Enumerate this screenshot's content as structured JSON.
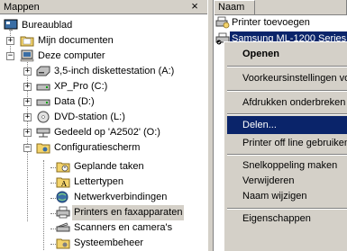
{
  "folders_pane": {
    "title": "Mappen",
    "close_glyph": "×",
    "tree": [
      {
        "label": "Bureaublad",
        "icon": "desktop-icon"
      },
      {
        "label": "Mijn documenten",
        "icon": "folder-icon",
        "expander": "+"
      },
      {
        "label": "Deze computer",
        "icon": "computer-icon",
        "expander": "−"
      },
      {
        "label": "3,5-inch diskettestation (A:)",
        "icon": "floppy-drive-icon",
        "expander": "+"
      },
      {
        "label": "XP_Pro (C:)",
        "icon": "hard-drive-icon",
        "expander": "+"
      },
      {
        "label": "Data (D:)",
        "icon": "hard-drive-icon",
        "expander": "+"
      },
      {
        "label": "DVD-station (L:)",
        "icon": "dvd-drive-icon",
        "expander": "+"
      },
      {
        "label": "Gedeeld op 'A2502' (O:)",
        "icon": "network-drive-icon",
        "expander": "+"
      },
      {
        "label": "Configuratiescherm",
        "icon": "control-panel-icon",
        "expander": "−"
      },
      {
        "label": "Geplande taken",
        "icon": "scheduled-tasks-icon"
      },
      {
        "label": "Lettertypen",
        "icon": "fonts-folder-icon"
      },
      {
        "label": "Netwerkverbindingen",
        "icon": "network-connections-icon"
      },
      {
        "label": "Printers en faxapparaten",
        "icon": "printers-icon",
        "selected": true
      },
      {
        "label": "Scanners en camera's",
        "icon": "scanner-camera-icon"
      },
      {
        "label": "Systeembeheer",
        "icon": "admin-tools-icon"
      }
    ]
  },
  "list_pane": {
    "column_name": "Naam",
    "items": [
      {
        "label": "Printer toevoegen",
        "icon": "add-printer-icon"
      },
      {
        "label": "Samsung ML-1200 Series",
        "icon": "printer-icon",
        "selected": true
      }
    ]
  },
  "context_menu": {
    "items": [
      {
        "label": "Openen",
        "bold": true
      },
      {
        "separator": true
      },
      {
        "label": "Voorkeursinstellingen voor afdrukken..."
      },
      {
        "separator": true
      },
      {
        "label": "Afdrukken onderbreken"
      },
      {
        "separator": true
      },
      {
        "label": "Delen...",
        "highlighted": true
      },
      {
        "label": "Printer off line gebruiken"
      },
      {
        "separator": true
      },
      {
        "label": "Snelkoppeling maken"
      },
      {
        "label": "Verwijderen"
      },
      {
        "label": "Naam wijzigen"
      },
      {
        "separator": true
      },
      {
        "label": "Eigenschappen"
      }
    ]
  },
  "colors": {
    "selection": "#0a246a",
    "face": "#d4d0c8"
  }
}
